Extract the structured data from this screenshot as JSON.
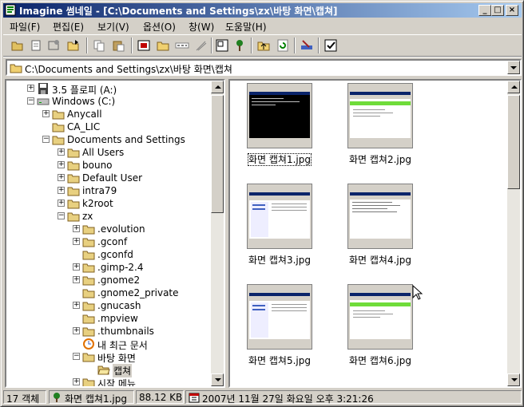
{
  "window": {
    "title": "Imagine 썸네일 - [C:\\Documents and Settings\\zx\\바탕 화면\\캡쳐]"
  },
  "menu": [
    "파일(F)",
    "편집(E)",
    "보기(V)",
    "옵션(O)",
    "창(W)",
    "도움말(H)"
  ],
  "path": {
    "value": "C:\\Documents and Settings\\zx\\바탕 화면\\캡쳐"
  },
  "tree": [
    {
      "label": "3.5 플로피 (A:)",
      "level": 1,
      "exp": "+",
      "icon": "floppy-icon"
    },
    {
      "label": "Windows (C:)",
      "level": 1,
      "exp": "-",
      "icon": "drive-icon"
    },
    {
      "label": "Anycall",
      "level": 2,
      "exp": "+",
      "icon": "folder-icon"
    },
    {
      "label": "CA_LIC",
      "level": 2,
      "exp": "",
      "icon": "folder-icon"
    },
    {
      "label": "Documents and Settings",
      "level": 2,
      "exp": "-",
      "icon": "folder-icon"
    },
    {
      "label": "All Users",
      "level": 3,
      "exp": "+",
      "icon": "folder-icon"
    },
    {
      "label": "bouno",
      "level": 3,
      "exp": "+",
      "icon": "folder-icon"
    },
    {
      "label": "Default User",
      "level": 3,
      "exp": "+",
      "icon": "folder-icon"
    },
    {
      "label": "intra79",
      "level": 3,
      "exp": "+",
      "icon": "folder-icon"
    },
    {
      "label": "k2root",
      "level": 3,
      "exp": "+",
      "icon": "folder-icon"
    },
    {
      "label": "zx",
      "level": 3,
      "exp": "-",
      "icon": "folder-icon"
    },
    {
      "label": ".evolution",
      "level": 4,
      "exp": "+",
      "icon": "folder-icon"
    },
    {
      "label": ".gconf",
      "level": 4,
      "exp": "+",
      "icon": "folder-icon"
    },
    {
      "label": ".gconfd",
      "level": 4,
      "exp": "",
      "icon": "folder-icon"
    },
    {
      "label": ".gimp-2.4",
      "level": 4,
      "exp": "+",
      "icon": "folder-icon"
    },
    {
      "label": ".gnome2",
      "level": 4,
      "exp": "+",
      "icon": "folder-icon"
    },
    {
      "label": ".gnome2_private",
      "level": 4,
      "exp": "",
      "icon": "folder-icon"
    },
    {
      "label": ".gnucash",
      "level": 4,
      "exp": "+",
      "icon": "folder-icon"
    },
    {
      "label": ".mpview",
      "level": 4,
      "exp": "",
      "icon": "folder-icon"
    },
    {
      "label": ".thumbnails",
      "level": 4,
      "exp": "+",
      "icon": "folder-icon"
    },
    {
      "label": "내 최근 문서",
      "level": 4,
      "exp": "",
      "icon": "recent-docs-icon"
    },
    {
      "label": "바탕 화면",
      "level": 4,
      "exp": "-",
      "icon": "folder-icon"
    },
    {
      "label": "캡쳐",
      "level": 5,
      "exp": "",
      "icon": "open-folder-icon",
      "selected": true
    },
    {
      "label": "시작 메뉴",
      "level": 4,
      "exp": "+",
      "icon": "folder-icon"
    }
  ],
  "thumbnails": [
    {
      "name": "화면 캡쳐1.jpg",
      "style": "console",
      "selected": true
    },
    {
      "name": "화면 캡쳐2.jpg",
      "style": "green"
    },
    {
      "name": "화면 캡쳐3.jpg",
      "style": "explorer"
    },
    {
      "name": "화면 캡쳐4.jpg",
      "style": "text"
    },
    {
      "name": "화면 캡쳐5.jpg",
      "style": "explorer"
    },
    {
      "name": "화면 캡쳐6.jpg",
      "style": "green"
    }
  ],
  "status": {
    "count": "17 객체",
    "file": "화면 캡쳐1.jpg",
    "size": "88.12 KB",
    "date": "2007년 11월 27일 화요일 오후 3:21:26"
  }
}
